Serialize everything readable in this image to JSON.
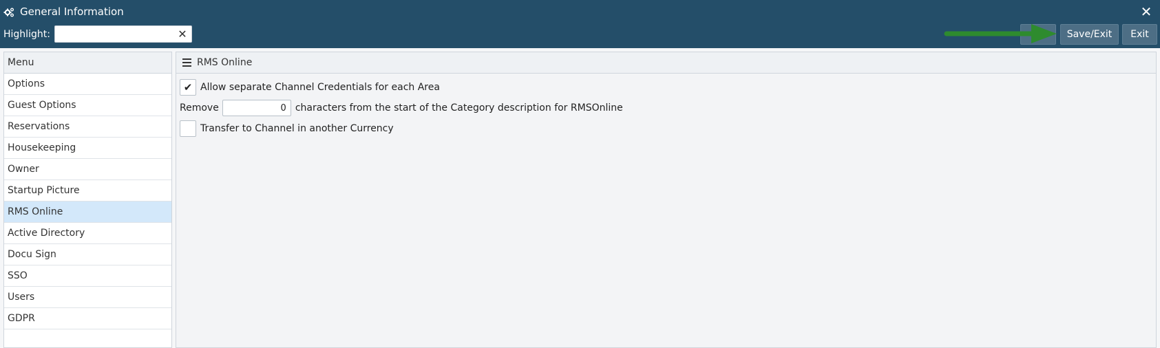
{
  "window": {
    "title": "General Information",
    "close_icon": "close-icon",
    "settings_icon": "gears-icon"
  },
  "toolbar": {
    "highlight_label": "Highlight:",
    "highlight_value": "",
    "blank_label": "",
    "save_exit_label": "Save/Exit",
    "exit_label": "Exit",
    "arrow_color": "#2e8b2e"
  },
  "sidebar": {
    "header": "Menu",
    "items": [
      {
        "label": "Options"
      },
      {
        "label": "Guest Options"
      },
      {
        "label": "Reservations"
      },
      {
        "label": "Housekeeping"
      },
      {
        "label": "Owner"
      },
      {
        "label": "Startup Picture"
      },
      {
        "label": "RMS Online",
        "active": true
      },
      {
        "label": "Active Directory"
      },
      {
        "label": "Docu Sign"
      },
      {
        "label": "SSO"
      },
      {
        "label": "Users"
      },
      {
        "label": "GDPR"
      }
    ]
  },
  "main": {
    "title": "RMS Online",
    "allow_separate": {
      "label": "Allow separate Channel Credentials for each Area",
      "checked": true
    },
    "remove": {
      "prefix": "Remove",
      "value": "0",
      "suffix": "characters from the start of the Category description for RMSOnline"
    },
    "transfer": {
      "label": "Transfer to Channel in another Currency",
      "checked": false
    }
  },
  "colors": {
    "titlebar": "#244e69",
    "button": "#4d6e85",
    "active_item": "#d3e8fa"
  }
}
